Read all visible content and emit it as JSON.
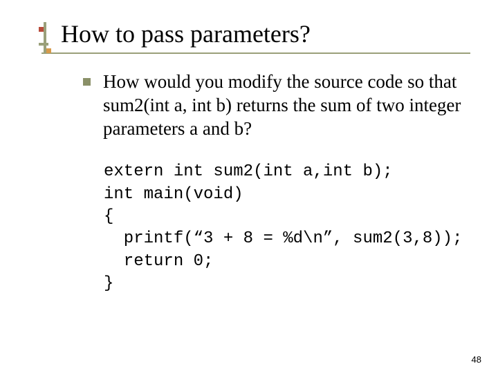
{
  "title": "How to pass parameters?",
  "bullet_text": "How would you modify the source code so that sum2(int a, int b) returns the sum of two integer parameters a and b?",
  "code": "extern int sum2(int a,int b);\nint main(void)\n{\n  printf(“3 + 8 = %d\\n”, sum2(3,8));\n  return 0;\n}",
  "page_number": "48"
}
